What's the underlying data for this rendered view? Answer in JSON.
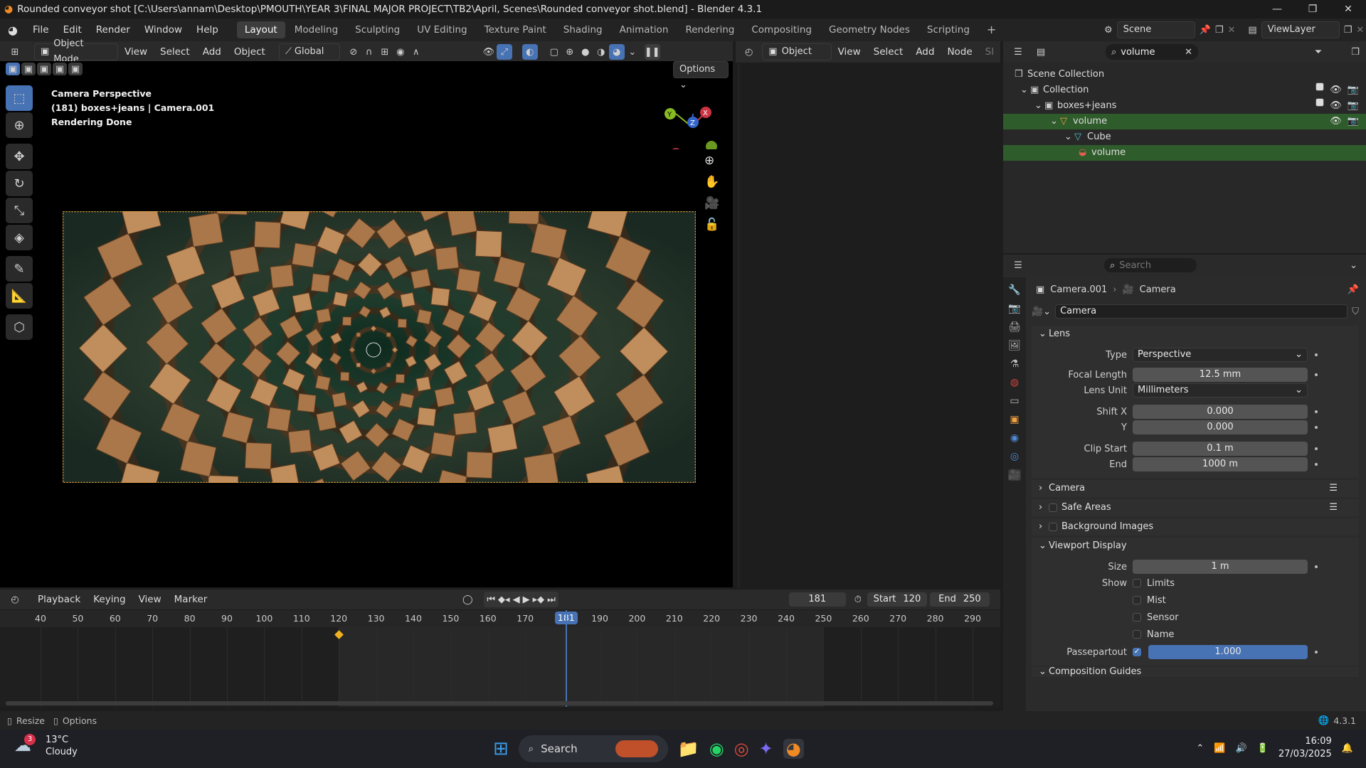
{
  "title_bar": {
    "title": "Rounded conveyor shot [C:\\Users\\annam\\Desktop\\PMOUTH\\YEAR 3\\FINAL MAJOR PROJECT\\TB2\\April, Scenes\\Rounded conveyor shot.blend] - Blender 4.3.1",
    "controls": [
      "—",
      "❐",
      "✕"
    ]
  },
  "menu": [
    "File",
    "Edit",
    "Render",
    "Window",
    "Help"
  ],
  "workspaces": [
    "Layout",
    "Modeling",
    "Sculpting",
    "UV Editing",
    "Texture Paint",
    "Shading",
    "Animation",
    "Rendering",
    "Compositing",
    "Geometry Nodes",
    "Scripting"
  ],
  "active_workspace": "Layout",
  "scene": {
    "label": "Scene",
    "view_layer": "ViewLayer"
  },
  "viewport_header": {
    "mode": "Object Mode",
    "menus": [
      "View",
      "Select",
      "Add",
      "Object"
    ],
    "transform": "Global",
    "options": "Options"
  },
  "viewport_overlay": {
    "line1": "Camera Perspective",
    "line2": "(181) boxes+jeans | Camera.001",
    "line3": "Rendering Done"
  },
  "node_header": {
    "mode": "Object",
    "menus": [
      "View",
      "Select",
      "Add",
      "Node"
    ],
    "cut": "Sl"
  },
  "outliner": {
    "search": "volume",
    "rows": [
      {
        "label": "Scene Collection",
        "indent": 0
      },
      {
        "label": "Collection",
        "indent": 1
      },
      {
        "label": "boxes+jeans",
        "indent": 2
      },
      {
        "label": "volume",
        "indent": 3,
        "selected": true
      },
      {
        "label": "Cube",
        "indent": 4
      },
      {
        "label": "volume",
        "indent": 5,
        "selected": true
      }
    ]
  },
  "properties": {
    "search_placeholder": "Search",
    "breadcrumb": [
      "Camera.001",
      "Camera"
    ],
    "datablock": "Camera",
    "lens": {
      "title": "Lens",
      "type_label": "Type",
      "type_value": "Perspective",
      "focal_label": "Focal Length",
      "focal_value": "12.5 mm",
      "unit_label": "Lens Unit",
      "unit_value": "Millimeters",
      "shiftx_label": "Shift X",
      "shiftx_value": "0.000",
      "shifty_label": "Y",
      "shifty_value": "0.000",
      "clipstart_label": "Clip Start",
      "clipstart_value": "0.1 m",
      "clipend_label": "End",
      "clipend_value": "1000 m"
    },
    "collapsed_sections": [
      "Camera",
      "Safe Areas",
      "Background Images"
    ],
    "viewport_display": {
      "title": "Viewport Display",
      "size_label": "Size",
      "size_value": "1 m",
      "show_label": "Show",
      "checks": [
        "Limits",
        "Mist",
        "Sensor",
        "Name"
      ],
      "passepartout_label": "Passepartout",
      "passepartout_value": "1.000",
      "passepartout_fraction": 1.0,
      "next_section": "Composition Guides"
    }
  },
  "timeline": {
    "menus": [
      "Playback",
      "Keying",
      "View",
      "Marker"
    ],
    "current_frame": "181",
    "start_label": "Start",
    "start": "120",
    "end_label": "End",
    "end": "250",
    "ticks": [
      "40",
      "50",
      "60",
      "70",
      "80",
      "90",
      "100",
      "110",
      "120",
      "130",
      "140",
      "150",
      "160",
      "170",
      "180",
      "190",
      "200",
      "210",
      "220",
      "230",
      "240",
      "250",
      "260",
      "270",
      "280",
      "290"
    ],
    "playhead_label": "181"
  },
  "statusbar": {
    "resize": "Resize",
    "options": "Options",
    "version": "4.3.1"
  },
  "taskbar": {
    "weather_temp": "13°C",
    "weather_desc": "Cloudy",
    "weather_badge": "3",
    "search": "Search",
    "time": "16:09",
    "date": "27/03/2025"
  },
  "colors": {
    "accent": "#4772b3",
    "outliner_selected": "#2f5c2b",
    "frame_outline": "#e8a33a",
    "keyframe": "#f0b020"
  }
}
